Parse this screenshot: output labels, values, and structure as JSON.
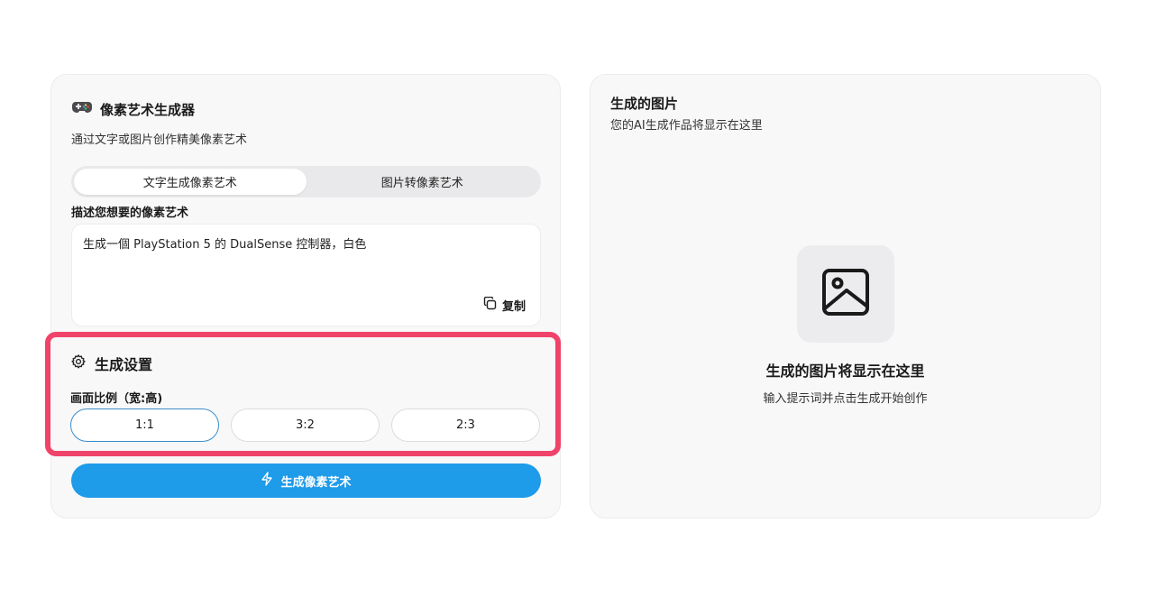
{
  "generator": {
    "icon": "gamepad-icon",
    "title": "像素艺术生成器",
    "subtitle": "通过文字或图片创作精美像素艺术",
    "tabs": [
      {
        "label": "文字生成像素艺术",
        "active": true
      },
      {
        "label": "图片转像素艺术",
        "active": false
      }
    ],
    "prompt_label": "描述您想要的像素艺术",
    "prompt_value": "生成一個 PlayStation 5 的 DualSense 控制器，白色",
    "copy_label": "复制"
  },
  "settings": {
    "title": "生成设置",
    "ratio_label": "画面比例（宽:高)",
    "ratios": [
      "1:1",
      "3:2",
      "2:3"
    ],
    "selected_ratio": "1:1",
    "highlight_color": "#f0436a"
  },
  "generate_button": {
    "label": "生成像素艺术",
    "color": "#1e9be9"
  },
  "result": {
    "title": "生成的图片",
    "subtitle": "您的AI生成作品将显示在这里",
    "empty_title": "生成的图片将显示在这里",
    "empty_subtitle": "输入提示词并点击生成开始创作"
  }
}
